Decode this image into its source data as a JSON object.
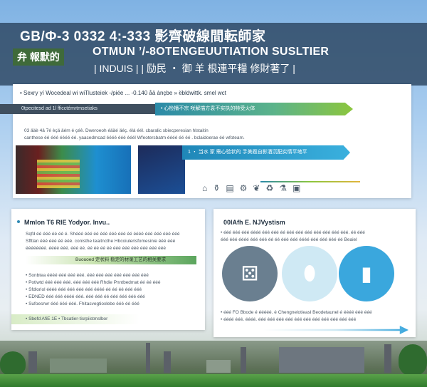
{
  "header": {
    "line1": "GB/Ф-3 0332 4:-333 影齊破線間転師家",
    "badge": "弁 報默的",
    "subtitle": "OTMUN ’/-8OTENGEUUTIATION SUSLTIER",
    "tags": "| INDUIS | |  励民 ‧ 御 羊 根連平糧 修財著了 |"
  },
  "top_panel": {
    "description": "• Sexry yí Wocedeal wi wiTlusteiek -/piée ... -0.140 åä ànçbe » ëbldwittk. smel wct",
    "dark_bar": "0tpecitesd   ad 1l  fficctémrtmsetiaks",
    "green_bar": "• 心检播不宗 咲解描方袁不实执的特受火体",
    "text_lines": [
      "03 ääè 4ä 7é èçä äém é çéê. Dweroeoh éääé äéç. élá éél. cbaralic sbiecperesian hlstaitin",
      "canthese éé ééé éééé éé. yaacedmcad éééé ééé ééél Wfeotersbatm éééé éé éé . bclaidoerae éé wfoteam."
    ],
    "blue_bar": "1 ‧ 当水 家 需心验状的 手美题自影酒沉配实情平地平",
    "icons": [
      "factory-icon",
      "bottle-icon",
      "chart-icon",
      "gear-icon",
      "leaf-icon",
      "recycle-icon",
      "flask-icon",
      "truck-icon"
    ]
  },
  "left_card": {
    "title": "Mmlon T6 RIE Yodyor.  Invu..",
    "lines": [
      "Sqfd éé ééé éé éé é. Shééé ééé éé ééé ééé ééé éé éééé ééé ééé ééé ééé",
      "Sfftlan  ééé ééé éé ééé. conisthe  teaitncthe Hbcoiulerisfomesinie ééé ééé",
      "éééééééé. éééé ééé. ééé éé. éé éé éé éé ééé ééé ééé ééé ééé ééé"
    ],
    "band": "Buouoed  定状料 稳定的材录工艺的相关要求",
    "bullets": [
      "• Sonbtea  éééé  ééé ééé ééé.  ééé ééé  ééé ééé ééé ééé ééé",
      "• Potiwtd  ééé ééé ééé.  ééé ééé ééé  Rhdie Pnntbedmat  éé éé ééé",
      "• Sfdloriol  éééé ééé ééé  ééé ééé éééé éé éé éé ééé ééé",
      "• EDNED  ééé ééé  éééé ééé. ééé ééé éé  ééé ééé  ééé ééé",
      "• Sufoesrwr  ééé ééé ééé.  Fhitasvegtioxlebe ééé éé ééé"
    ],
    "footer": "• Sbefd  AfiE  1E  • Tbcatier-tisrpiistmslbor"
  },
  "right_card": {
    "title": "00lAfh  E. NJVystism",
    "lines": [
      "• ééé ééé ééé éééé ééé ééé éé ééé ééé ééé ééé  ééé ééé ééé. éé ééé",
      "ééé ééé éééé ééé ééé éé éé ééé ééé éééé ééé ééé  ééé éé Beaiel"
    ],
    "circle_icons": [
      "dice-icon",
      "tank-icon",
      "container-icon"
    ],
    "bullets": [
      "• ééé FO Bbode é ééééé. é Chengnelotieasl  Beodetaunel  é  éééé ééé ééé",
      "• éééé ééé. éééé. ééé ééé ééé ééé ééé ééé ééé ééé ééé ééé ééé"
    ]
  }
}
